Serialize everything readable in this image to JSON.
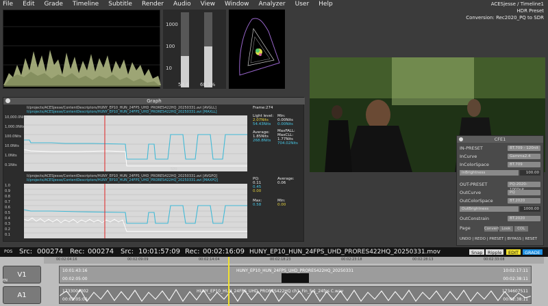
{
  "menu": [
    "File",
    "Edit",
    "Grade",
    "Timeline",
    "Subtitle",
    "Render",
    "Audio",
    "View",
    "Window",
    "Analyzer",
    "User",
    "Help"
  ],
  "project": {
    "title": "ACESjesse / Timeline1",
    "preset": "HDR Preset",
    "conversion": "Conversion: Rec2020_PQ to SDR"
  },
  "meters": {
    "scale": [
      "1000",
      "100",
      "10"
    ],
    "left_value": "54.4",
    "right_value": "68.1%",
    "left_level": 0.42,
    "right_level": 0.55
  },
  "graph": {
    "title": "Graph",
    "frame": "Frame:274",
    "paths1": [
      "li/projects/ACESjesse/ContentDescriptors/HUNY_EP10_HUN_24FPS_UHD_PRORES422HQ_20250331.avi [AVGLL]",
      "li/projects/ACESjesse/ContentDescriptors/HUNY_EP10_HUN_24FPS_UHD_PRORES422HQ_20250331.avi [MAXLL]"
    ],
    "paths2": [
      "li/projects/ACESjesse/ContentDescriptors/HUNY_EP10_HUN_24FPS_UHD_PRORES422HQ_20250331.avi [AVGPQ]",
      "li/projects/ACESjesse/ContentDescriptors/HUNY_EP10_HUN_24FPS_UHD_PRORES422HQ_20250331.avi [MAXPQ]"
    ],
    "ylabels1": [
      "10,000.0Nits",
      "1,000.0Nits",
      "100.0Nits",
      "10.0Nits",
      "1.0Nits",
      "0.1Nits"
    ],
    "ylabels2": [
      "1.0",
      "0.9",
      "0.8",
      "0.7",
      "0.6",
      "0.5",
      "0.4",
      "0.3",
      "0.2",
      "0.1"
    ],
    "xtick": "500",
    "stats1": {
      "light_label": "Light level:",
      "light": "2.07Nits",
      "light2": "54.43Nits",
      "min_label": "Min:",
      "min": "0.00Nits",
      "min2": "0.00Nits",
      "avg_label": "Average:",
      "avg": "1.85Nits",
      "avg2": "268.8Nits",
      "maxfall_label": "MaxFALL:",
      "maxcll_label": "MaxCLL:",
      "maxcll": "1.77Nits",
      "maxcll2": "704.02Nits"
    },
    "stats2": {
      "pq_label": "PQ:",
      "pq": "0.11",
      "pq2": "0.45",
      "pq3": "0.00",
      "avg_label": "Average:",
      "avg": "0.06",
      "max_label": "Max:",
      "max": "0.58",
      "min_label": "Min:",
      "min": "0.00"
    }
  },
  "cfe": {
    "title": "CFE1",
    "in_preset_label": "IN-PRESET",
    "in_preset": "BT.709 - 120nit",
    "in_curve_label": "InCurve",
    "in_curve": "Gamma2.4",
    "in_colorspace_label": "InColorSpace",
    "in_colorspace": "BT.709",
    "in_brightness_label": "InBrightness",
    "in_brightness": "100.00",
    "out_preset_label": "OUT-PRESET",
    "out_preset": "PQ-2020-1000nit",
    "out_curve_label": "OutCurve",
    "out_curve": "PQ",
    "out_colorspace_label": "OutColorSpace",
    "out_colorspace": "BT.2020",
    "out_brightness_label": "OutBrightness",
    "out_brightness": "1000.00",
    "out_constrain_label": "OutConstrain",
    "out_constrain": "BT.2020",
    "page_label": "Page",
    "page_buttons": [
      "Convert",
      "Look",
      "COL"
    ],
    "actions": "UNDO | REDO | PRESET | BYPASS | RESET"
  },
  "transport": {
    "pos": "POS",
    "src_label": "Src:",
    "src": "000274",
    "rec_label": "Rec:",
    "rec": "000274",
    "src_tc_label": "Src:",
    "src_tc": "10:01:57:09",
    "rec_tc_label": "Rec:",
    "rec_tc": "00:02:16:09",
    "clip": "HUNY_EP10_HUN_24FPS_UHD_PRORES422HQ_20250331.mov"
  },
  "timeline": {
    "buttons": {
      "snap": "Snap",
      "ripple": "Ripple",
      "edit": "EDIT",
      "grade": "GRADE"
    },
    "ruler": [
      "00:02:04:16",
      "00:02:09:09",
      "00:02:14:04",
      "00:02:18:23",
      "00:02:23:18",
      "00:02:28:13",
      "00:02:33:08"
    ],
    "v1": "V1",
    "v1_sub": "EN",
    "a1": "A1",
    "v_clip_tc1": "10:01:43:16",
    "v_clip_tc2": "00:02:05:00",
    "v_clip_name": "HUNY_EP10_HUN_24FPS_UHD_PRORES422HQ_20250331",
    "v_clip_end1": "10:02:17:11",
    "v_clip_end2": "00:02:38:11",
    "a_clip_tc1": "1733004002",
    "a_clip_tc2": "00:02:05:00",
    "a_clip_name": "HUNY_EP10_HUN_24FPS_UHD_PRORES422HQ ch1_Fin_5.1_24fps C.wav",
    "a_clip_end1": "1734607511",
    "a_clip_end2": "00:02:38:11"
  }
}
